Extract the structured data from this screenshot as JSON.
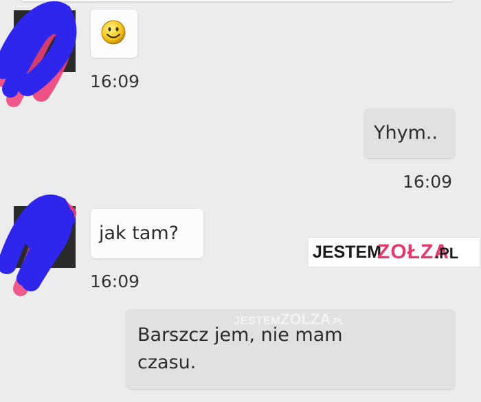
{
  "messages": [
    {
      "sender": "contact",
      "content": "emoji",
      "emoji_name": "smiley-emoji",
      "time": "16:09"
    },
    {
      "sender": "me",
      "text": "Yhym..",
      "time": "16:09"
    },
    {
      "sender": "contact",
      "text": "jak tam?",
      "time": "16:09"
    },
    {
      "sender": "me",
      "text_line1": "Barszcz jem, nie mam",
      "text_line2": "czasu."
    }
  ],
  "watermark": {
    "part1": "JESTEM",
    "part2": "ZOŁZA",
    "part3": ".PL"
  },
  "watermark_faint": {
    "part1": "JESTEM",
    "part2": "ZOLZA",
    "part3": ".PL"
  },
  "colors": {
    "background": "#ececec",
    "incoming_bubble": "#fcfcfc",
    "outgoing_bubble": "#e1e1e1",
    "scribble_blue": "#2f26ee",
    "scribble_pink": "#f0407a",
    "watermark_accent": "#e5396d"
  }
}
